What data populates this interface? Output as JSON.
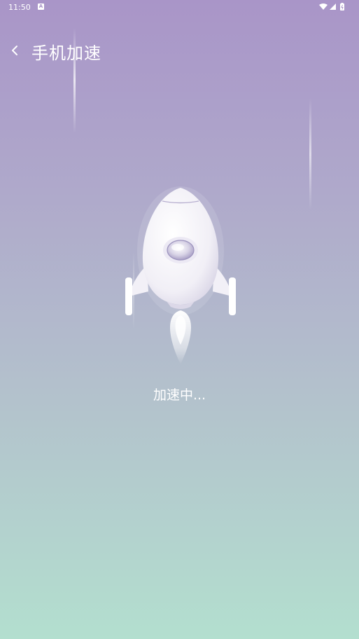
{
  "status_bar": {
    "time": "11:50",
    "notification_icon": "a-notification-icon",
    "icons": [
      "wifi-icon",
      "signal-icon",
      "battery-icon"
    ]
  },
  "header": {
    "back_icon": "chevron-left-icon",
    "title": "手机加速"
  },
  "main": {
    "illustration": "rocket-icon",
    "status_text": "加速中..."
  },
  "colors": {
    "gradient_top": "#a995c8",
    "gradient_middle": "#b3c0cc",
    "gradient_bottom": "#b3dfcf",
    "text": "#ffffff"
  }
}
